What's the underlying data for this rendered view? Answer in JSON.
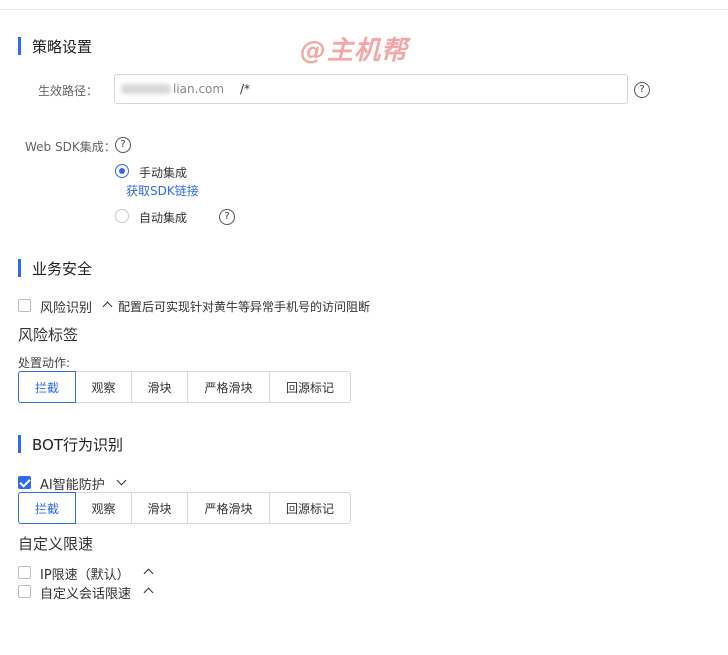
{
  "watermark": "@主机帮",
  "strategy": {
    "title": "策略设置",
    "path_label": "生效路径：",
    "path_domain_tail": "lian.com",
    "path_value": "/*",
    "help_icon": "question-circle-icon",
    "sdk_label": "Web SDK集成：",
    "manual_label": "手动集成",
    "sdk_link": "获取SDK链接",
    "auto_label": "自动集成",
    "selected": "手动集成"
  },
  "business": {
    "title": "业务安全",
    "risk_label": "风险识别",
    "risk_hint": "配置后可实现针对黄牛等异常手机号的访问阻断",
    "risk_tag_title": "风险标签",
    "action_label": "处置动作:",
    "actions": [
      "拦截",
      "观察",
      "滑块",
      "严格滑块",
      "回源标记"
    ],
    "active_action": "拦截"
  },
  "bot": {
    "title": "BOT行为识别",
    "ai_label": "AI智能防护",
    "ai_checked": true,
    "actions": [
      "拦截",
      "观察",
      "滑块",
      "严格滑块",
      "回源标记"
    ],
    "active_action": "拦截",
    "rate_title": "自定义限速",
    "ip_rate_label": "IP限速（默认）",
    "session_rate_label": "自定义会话限速"
  },
  "colors": {
    "accent": "#2f6bef",
    "watermark": "#f08a8a"
  }
}
